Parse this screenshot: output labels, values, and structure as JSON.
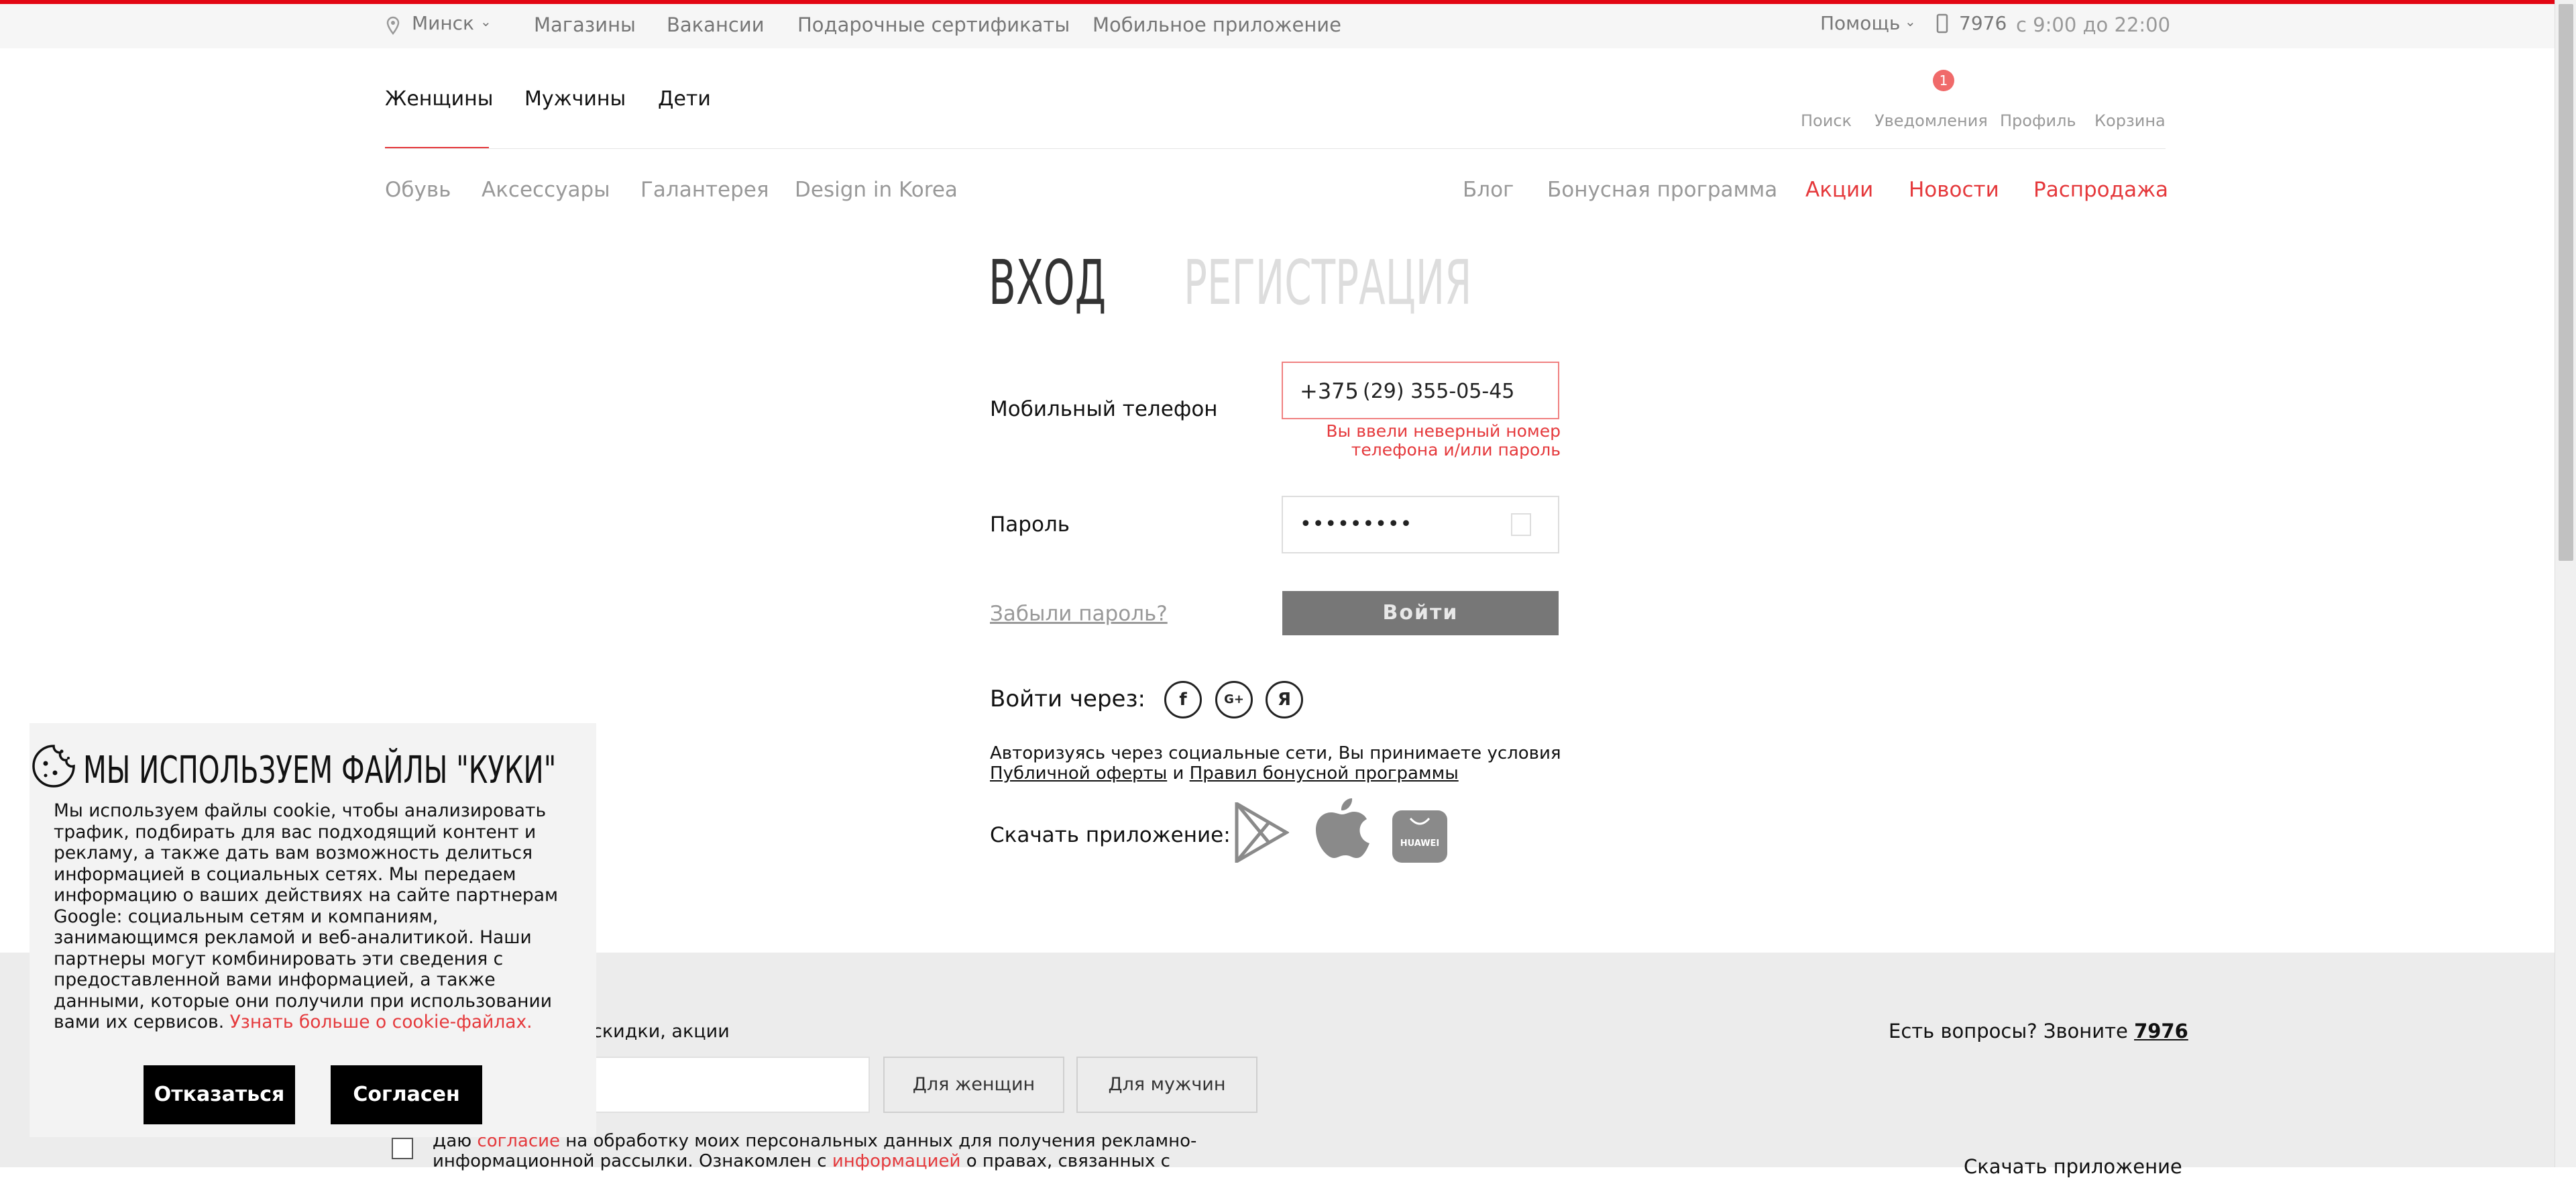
{
  "topbar": {
    "city": "Минск",
    "links": [
      "Магазины",
      "Вакансии",
      "Подарочные сертификаты",
      "Мобильное приложение"
    ],
    "help": "Помощь",
    "phone": "7976",
    "hours": "с 9:00 до 22:00"
  },
  "nav": {
    "main": [
      "Женщины",
      "Мужчины",
      "Дети"
    ],
    "active": "Женщины",
    "icons": {
      "search": "Поиск",
      "notifications": "Уведомления",
      "notifications_badge": "1",
      "profile": "Профиль",
      "cart": "Корзина"
    },
    "categories": [
      "Обувь",
      "Аксессуары",
      "Галантерея",
      "Design in Korea"
    ],
    "right": [
      "Блог",
      "Бонусная программа"
    ],
    "right_red": [
      "Акции",
      "Новости",
      "Распродажа"
    ]
  },
  "auth": {
    "tab_login": "ВХОД",
    "tab_register": "РЕГИСТРАЦИЯ",
    "phone_label": "Мобильный телефон",
    "phone_prefix": "+375",
    "phone_value": "(29) 355-05-45",
    "error_line1": "Вы ввели неверный номер",
    "error_line2": "телефона и/или пароль",
    "password_label": "Пароль",
    "password_value": "•••••••••",
    "forgot": "Забыли пароль?",
    "submit": "Войти",
    "social_label": "Войти через:",
    "social": [
      "f",
      "G+",
      "Я"
    ],
    "terms_line1": "Авторизуясь через социальные сети, Вы принимаете условия",
    "terms_link1": "Публичной оферты",
    "terms_and": " и ",
    "terms_link2": "Правил бонусной программы",
    "app_label": "Скачать приложение:",
    "huawei": "HUAWEI"
  },
  "footer": {
    "subscribe_text": "ки, скидки, акции",
    "questions": "Есть вопросы? Звоните",
    "phone": "7976",
    "btn_women": "Для женщин",
    "btn_men": "Для мужчин",
    "consent_prefix": "Даю",
    "consent_link": "согласие",
    "consent_rest": "на обработку моих персональных данных для получения рекламно-",
    "consent_line2_a": "информационной рассылки. Ознакомлен с",
    "consent_link2": "информацией",
    "consent_line2_b": "о правах, связанных с",
    "download_partial": "Скачать приложение"
  },
  "cookie": {
    "title": "МЫ ИСПОЛЬЗУЕМ ФАЙЛЫ \"КУКИ\"",
    "lines": [
      "Мы используем файлы cookie, чтобы анализировать",
      "трафик, подбирать для вас подходящий контент и",
      "рекламу, а также дать вам возможность делиться",
      "информацией в социальных сетях. Мы передаем",
      "информацию о ваших действиях на сайте партнерам",
      "Google: социальным сетям и компаниям,",
      "занимающимся рекламой и веб-аналитикой. Наши",
      "партнеры могут комбинировать эти сведения с",
      "предоставленной вами информацией, а также",
      "данными, которые они получили при использовании"
    ],
    "last_line": "вами их сервисов.",
    "link": "Узнать больше о cookie-файлах.",
    "decline": "Отказаться",
    "accept": "Согласен"
  },
  "colors": {
    "accent": "#e5393c",
    "cookie_bg": "#f3f3f3",
    "footer_bg": "#ececec"
  }
}
